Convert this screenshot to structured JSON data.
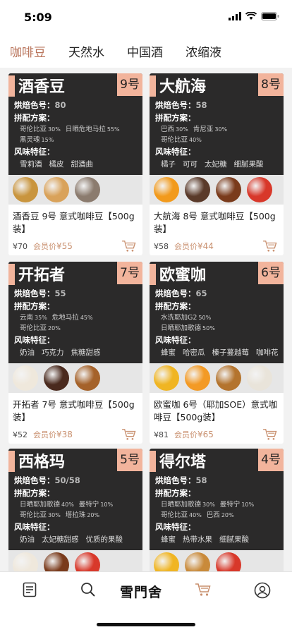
{
  "status_bar": {
    "time": "5:09"
  },
  "tabs": [
    {
      "label": "咖啡豆"
    },
    {
      "label": "天然水"
    },
    {
      "label": "中国酒"
    },
    {
      "label": "浓缩液"
    }
  ],
  "labels": {
    "roast": "烘焙色号：",
    "blend": "拼配方案：",
    "flavor": "风味特征："
  },
  "products": [
    {
      "name": "酒香豆",
      "number": "9号",
      "roast": "80",
      "blend": [
        [
          {
            "o": "哥伦比亚",
            "p": "30%"
          },
          {
            "o": "日晒危地马拉",
            "p": "55%"
          }
        ],
        [
          {
            "o": "黑灵魂",
            "p": "15%"
          }
        ]
      ],
      "flavors": [
        "雪莉酒",
        "橘皮",
        "甜酒曲"
      ],
      "photo_colors": [
        "#c9953e",
        "#d9a25a",
        "#8b7b6e"
      ],
      "title": "酒香豆 9号 意式咖啡豆【500g装】",
      "price": "¥70",
      "member_label": "会员价",
      "member_price": "¥55"
    },
    {
      "name": "大航海",
      "number": "8号",
      "roast": "58",
      "blend": [
        [
          {
            "o": "巴西",
            "p": "30%"
          },
          {
            "o": "肯尼亚",
            "p": "30%"
          }
        ],
        [
          {
            "o": "哥伦比亚",
            "p": "40%"
          }
        ]
      ],
      "flavors": [
        "橘子",
        "可可",
        "太妃糖",
        "细腻果酸"
      ],
      "photo_colors": [
        "#f29a1c",
        "#5a3a2a",
        "#7a3b1c",
        "#d8382a"
      ],
      "title": "大航海 8号 意式咖啡豆【500g装】",
      "price": "¥58",
      "member_label": "会员价",
      "member_price": "¥44"
    },
    {
      "name": "开拓者",
      "number": "7号",
      "roast": "55",
      "blend": [
        [
          {
            "o": "云南",
            "p": "35%"
          },
          {
            "o": "危地马拉",
            "p": "45%"
          }
        ],
        [
          {
            "o": "哥伦比亚",
            "p": "20%"
          }
        ]
      ],
      "flavors": [
        "奶油",
        "巧克力",
        "焦糖甜感"
      ],
      "photo_colors": [
        "#efe8dc",
        "#4a2a1e",
        "#a5622a"
      ],
      "title": "开拓者 7号 意式咖啡豆【500g装】",
      "price": "¥52",
      "member_label": "会员价",
      "member_price": "¥38"
    },
    {
      "name": "欧蜜咖",
      "number": "6号",
      "roast": "65",
      "blend": [
        [
          {
            "o": "水洗耶加G2",
            "p": "50%"
          }
        ],
        [
          {
            "o": "日晒耶加歌德",
            "p": "50%"
          }
        ]
      ],
      "flavors": [
        "蜂蜜",
        "哈密瓜",
        "榛子蔓越莓",
        "咖啡花"
      ],
      "photo_colors": [
        "#f0b523",
        "#f39a25",
        "#b4742e",
        "#e9e4da"
      ],
      "title": "欧蜜咖 6号（耶加SOE）意式咖啡豆【500g装】",
      "price": "¥81",
      "member_label": "会员价",
      "member_price": "¥65"
    },
    {
      "name": "西格玛",
      "number": "5号",
      "roast": "50/58",
      "blend": [
        [
          {
            "o": "日晒耶加歌德",
            "p": "40%"
          },
          {
            "o": "曼特宁",
            "p": "10%"
          }
        ],
        [
          {
            "o": "哥伦比亚",
            "p": "30%"
          },
          {
            "o": "塔拉珠",
            "p": "20%"
          }
        ]
      ],
      "flavors": [
        "奶油",
        "太妃糖甜感",
        "优质的果酸"
      ],
      "photo_colors": [
        "#efe8dc",
        "#7a3b1c",
        "#d8382a"
      ],
      "title": "",
      "price": "",
      "member_label": "",
      "member_price": ""
    },
    {
      "name": "得尔塔",
      "number": "4号",
      "roast": "58",
      "blend": [
        [
          {
            "o": "日晒耶加歌德",
            "p": "30%"
          },
          {
            "o": "曼特宁",
            "p": "10%"
          }
        ],
        [
          {
            "o": "哥伦比亚",
            "p": "40%"
          },
          {
            "o": "巴西",
            "p": "20%"
          }
        ]
      ],
      "flavors": [
        "蜂蜜",
        "热带水果",
        "细腻果酸"
      ],
      "photo_colors": [
        "#f0b523",
        "#c98a3a",
        "#d8382a"
      ],
      "title": "",
      "price": "",
      "member_label": "",
      "member_price": ""
    }
  ],
  "tabbar": {
    "logo_text": "雪門舍",
    "items": [
      "list-icon",
      "search-icon",
      "logo",
      "cart-icon",
      "user-icon"
    ],
    "accent": "#b9745b"
  },
  "colors": {
    "accent": "#b9745b",
    "badge": "#f2b49c",
    "card_dark": "#2b2a2a"
  }
}
